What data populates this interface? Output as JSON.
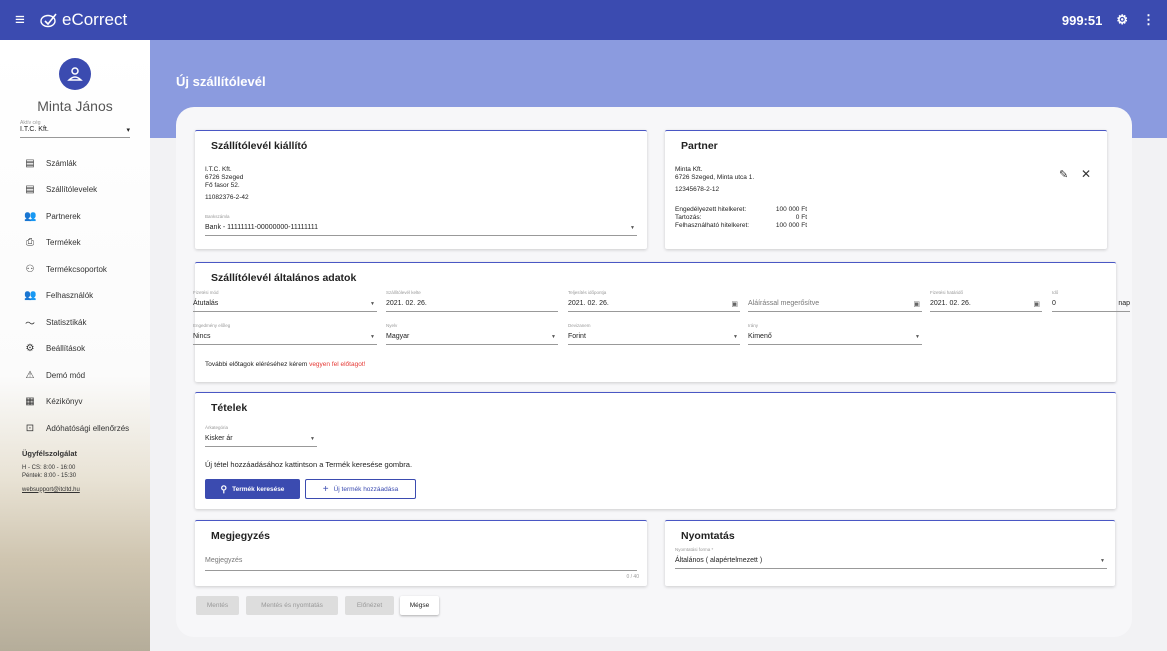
{
  "topbar": {
    "menu_icon": "hamburger-icon",
    "logo_text": "eCorrect",
    "timer": "999:51"
  },
  "user": {
    "name": "Minta János",
    "company_label": "Aktív cég",
    "company": "I.T.C. Kft."
  },
  "nav": [
    {
      "label": "Számlák",
      "icon": "▤"
    },
    {
      "label": "Szállítólevelek",
      "icon": "▤"
    },
    {
      "label": "Partnerek",
      "icon": "👥"
    },
    {
      "label": "Termékek",
      "icon": "⎙"
    },
    {
      "label": "Termékcsoportok",
      "icon": "⚇"
    },
    {
      "label": "Felhasználók",
      "icon": "👥"
    },
    {
      "label": "Statisztikák",
      "icon": "〜"
    },
    {
      "label": "Beállítások",
      "icon": "⚙"
    },
    {
      "label": "Demó mód",
      "icon": "⚠"
    },
    {
      "label": "Kézikönyv",
      "icon": "▦"
    },
    {
      "label": "Adóhatósági ellenőrzés",
      "icon": "⊡"
    }
  ],
  "support": {
    "title": "Ügyfélszolgálat",
    "hours1": "H - CS: 8:00 - 16:00",
    "hours2": "Péntek: 8:00 - 15:30",
    "email": "websupport@itcltd.hu"
  },
  "page": {
    "title": "Új szállítólevél"
  },
  "issuer": {
    "title": "Szállítólevél kiállító",
    "name": "I.T.C. Kft.",
    "city": "6726 Szeged",
    "street": "Fő fasor 52.",
    "tax": "11082376-2-42",
    "bank_label": "Bankszámla",
    "bank": "Bank - 11111111-00000000-11111111"
  },
  "partner": {
    "title": "Partner",
    "name": "Minta Kft.",
    "address": "6726 Szeged, Minta utca 1.",
    "tax": "12345678-2-12",
    "credit_label": "Engedélyezett hitelkeret:",
    "credit": "100 000 Ft",
    "debt_label": "Tartozás:",
    "debt": "0 Ft",
    "avail_label": "Felhasználható hitelkeret:",
    "avail": "100 000 Ft"
  },
  "general": {
    "title": "Szállítólevél általános adatok",
    "pay_label": "Fizetési mód",
    "pay": "Átutalás",
    "date_label": "Szállítólevél kelte",
    "date": "2021. 02. 26.",
    "perf_label": "Teljesítés időpontja",
    "perf": "2021. 02. 26.",
    "sign": "Aláírással megerősítve",
    "due_label": "Fizetési határidő",
    "due": "2021. 02. 26.",
    "time_label": "Idő",
    "time": "0",
    "time_unit": "nap",
    "discount_label": "Engedmény előleg",
    "discount": "Nincs",
    "lang_label": "Nyelv",
    "lang": "Magyar",
    "curr_label": "Devizanem",
    "curr": "Forint",
    "dir_label": "Irány",
    "dir": "Kimenő",
    "note_prefix": "További előtagok eléréséhez kérem ",
    "note_link": "vegyen fel előtagot!"
  },
  "items": {
    "title": "Tételek",
    "cat_label": "Árkategória",
    "cat": "Kisker ár",
    "hint": "Új tétel hozzáadásához kattintson a Termék keresése gombra.",
    "search_btn": "Termék keresése",
    "add_btn": "Új termék hozzáadása"
  },
  "remark": {
    "title": "Megjegyzés",
    "placeholder": "Megjegyzés",
    "counter": "0 / 40"
  },
  "print": {
    "title": "Nyomtatás",
    "form_label": "Nyomtatási forma *",
    "form": "Általános ( alapértelmezett )"
  },
  "actions": {
    "save": "Mentés",
    "save_print": "Mentés és nyomtatás",
    "preview": "Előnézet",
    "cancel": "Mégse"
  }
}
